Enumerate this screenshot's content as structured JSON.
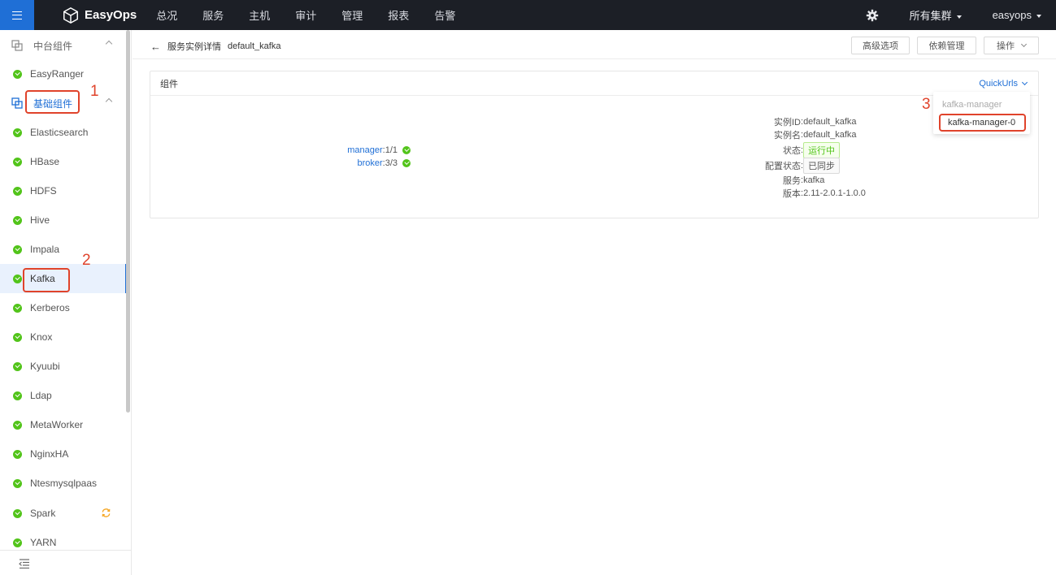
{
  "topbar": {
    "brand": "EasyOps",
    "nav": [
      "总况",
      "服务",
      "主机",
      "审计",
      "管理",
      "报表",
      "告警"
    ],
    "cluster": "所有集群",
    "user": "easyops"
  },
  "sidebar": {
    "group_top": "中台组件",
    "item_easyranger": "EasyRanger",
    "group_basic": "基础组件",
    "items": [
      "Elasticsearch",
      "HBase",
      "HDFS",
      "Hive",
      "Impala",
      "Kafka",
      "Kerberos",
      "Knox",
      "Kyuubi",
      "Ldap",
      "MetaWorker",
      "NginxHA",
      "Ntesmysqlpaas",
      "Spark",
      "YARN"
    ],
    "active": "Kafka"
  },
  "annotations": [
    "1",
    "2",
    "3"
  ],
  "header": {
    "back": "←",
    "page": "服务实例详情",
    "instance": "default_kafka",
    "btn_advanced": "高级选项",
    "btn_deps": "依赖管理",
    "btn_ops": "操作"
  },
  "card": {
    "title": "组件",
    "quickurls": "QuickUrls",
    "components": [
      {
        "name": "manager",
        "value": "1/1"
      },
      {
        "name": "broker",
        "value": "3/3"
      }
    ],
    "info": {
      "instance_id_label": "实例ID",
      "instance_id": "default_kafka",
      "instance_name_label": "实例名",
      "instance_name": "default_kafka",
      "status_label": "状态",
      "status": "运行中",
      "config_label": "配置状态",
      "config": "已同步",
      "service_label": "服务",
      "service": "kafka",
      "version_label": "版本",
      "version": "2.11-2.0.1-1.0.0"
    }
  },
  "dropdown": {
    "title": "kafka-manager",
    "item": "kafka-manager-0"
  },
  "colors": {
    "accent": "#1f6fd6",
    "success": "#52c41a",
    "annotation": "#e0432b",
    "topbar": "#1c1f26"
  }
}
